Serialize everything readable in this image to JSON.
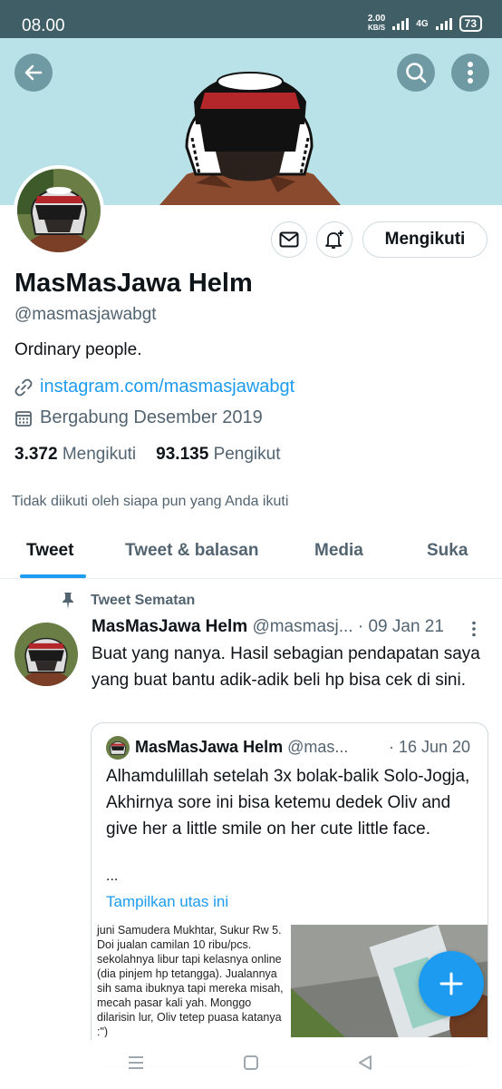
{
  "status_bar": {
    "time": "08.00",
    "net_speed_value": "2.00",
    "net_speed_unit": "KB/S",
    "network": "4G",
    "battery": "73"
  },
  "colors": {
    "accent": "#1d9bf0",
    "banner": "#b9e2e8",
    "status_bar": "#3f5e66",
    "muted_text": "#536471"
  },
  "header": {
    "back_icon": "arrow-left-icon",
    "search_icon": "search-icon",
    "more_icon": "more-vertical-icon"
  },
  "profile": {
    "display_name": "MasMasJawa Helm",
    "handle": "@masmasjawabgt",
    "bio": "Ordinary people.",
    "link": "instagram.com/masmasjawabgt",
    "joined": "Bergabung Desember 2019",
    "following_count": "3.372",
    "following_label": "Mengikuti",
    "followers_count": "93.135",
    "followers_label": "Pengikut",
    "not_followed_text": "Tidak diikuti oleh siapa pun yang Anda ikuti",
    "follow_button_label": "Mengikuti"
  },
  "tabs": [
    {
      "label": "Tweet",
      "active": true
    },
    {
      "label": "Tweet & balasan",
      "active": false
    },
    {
      "label": "Media",
      "active": false
    },
    {
      "label": "Suka",
      "active": false
    }
  ],
  "pinned_tweet": {
    "pinned_label": "Tweet Sematan",
    "author_name": "MasMasJawa Helm",
    "author_handle": "@masmasj...",
    "separator": "·",
    "date": "09 Jan 21",
    "text": "Buat yang nanya. Hasil sebagian pendapatan saya yang buat bantu adik-adik beli hp bisa cek di sini.",
    "quote": {
      "author_name": "MasMasJawa Helm",
      "author_handle": "@mas...",
      "date": "· 16 Jun 20",
      "text": "Alhamdulillah setelah 3x bolak-balik Solo-Jogja, Akhirnya sore ini bisa ketemu dedek Oliv and give her a little smile on her cute little face.",
      "ellipsis": "...",
      "show_thread": "Tampilkan utas ini",
      "image_text": "juni Samudera Mukhtar, Sukur Rw 5. Doi jualan camilan 10 ribu/pcs. sekolahnya libur tapi kelasnya online (dia pinjem hp tetangga). Jualannya sih sama ibuknya tapi mereka misah, mecah pasar kali yah. Monggo dilarisin lur, Oliv tetep puasa katanya :\")"
    }
  }
}
